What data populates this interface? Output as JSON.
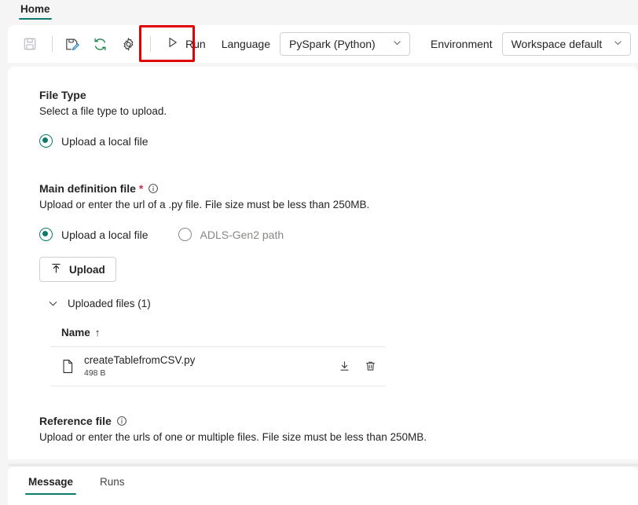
{
  "ribbon": {
    "tab": "Home"
  },
  "toolbar": {
    "icons": [
      {
        "name": "save-icon",
        "title": "Save"
      },
      {
        "name": "save-as-icon",
        "title": "Save as"
      },
      {
        "name": "refresh-icon",
        "title": "Refresh"
      },
      {
        "name": "settings-gear-icon",
        "title": "Settings"
      }
    ],
    "run_label": "Run",
    "language_label": "Language",
    "language_value": "PySpark (Python)",
    "environment_label": "Environment",
    "environment_value": "Workspace default",
    "highlight_color": "#e00000",
    "accent_color": "#0f7a6a"
  },
  "file_type": {
    "title": "File Type",
    "description": "Select a file type to upload.",
    "option_label": "Upload a local file",
    "option_selected": true
  },
  "main_definition": {
    "title": "Main definition file",
    "required_mark": "*",
    "description": "Upload or enter the url of a .py file. File size must be less than 250MB.",
    "options": [
      {
        "label": "Upload a local file",
        "selected": true
      },
      {
        "label": "ADLS-Gen2 path",
        "selected": false
      }
    ],
    "upload_button": "Upload",
    "uploaded_files_label": "Uploaded files (1)",
    "table": {
      "column_name": "Name",
      "sort_indicator": "↑",
      "rows": [
        {
          "filename": "createTablefromCSV.py",
          "size": "498 B",
          "download_action": "download-icon",
          "delete_action": "delete-icon"
        }
      ]
    }
  },
  "reference_file": {
    "title": "Reference file",
    "description": "Upload or enter the urls of one or multiple files. File size must be less than 250MB."
  },
  "bottom_tabs": {
    "tabs": [
      {
        "label": "Message",
        "active": true
      },
      {
        "label": "Runs",
        "active": false
      }
    ]
  }
}
